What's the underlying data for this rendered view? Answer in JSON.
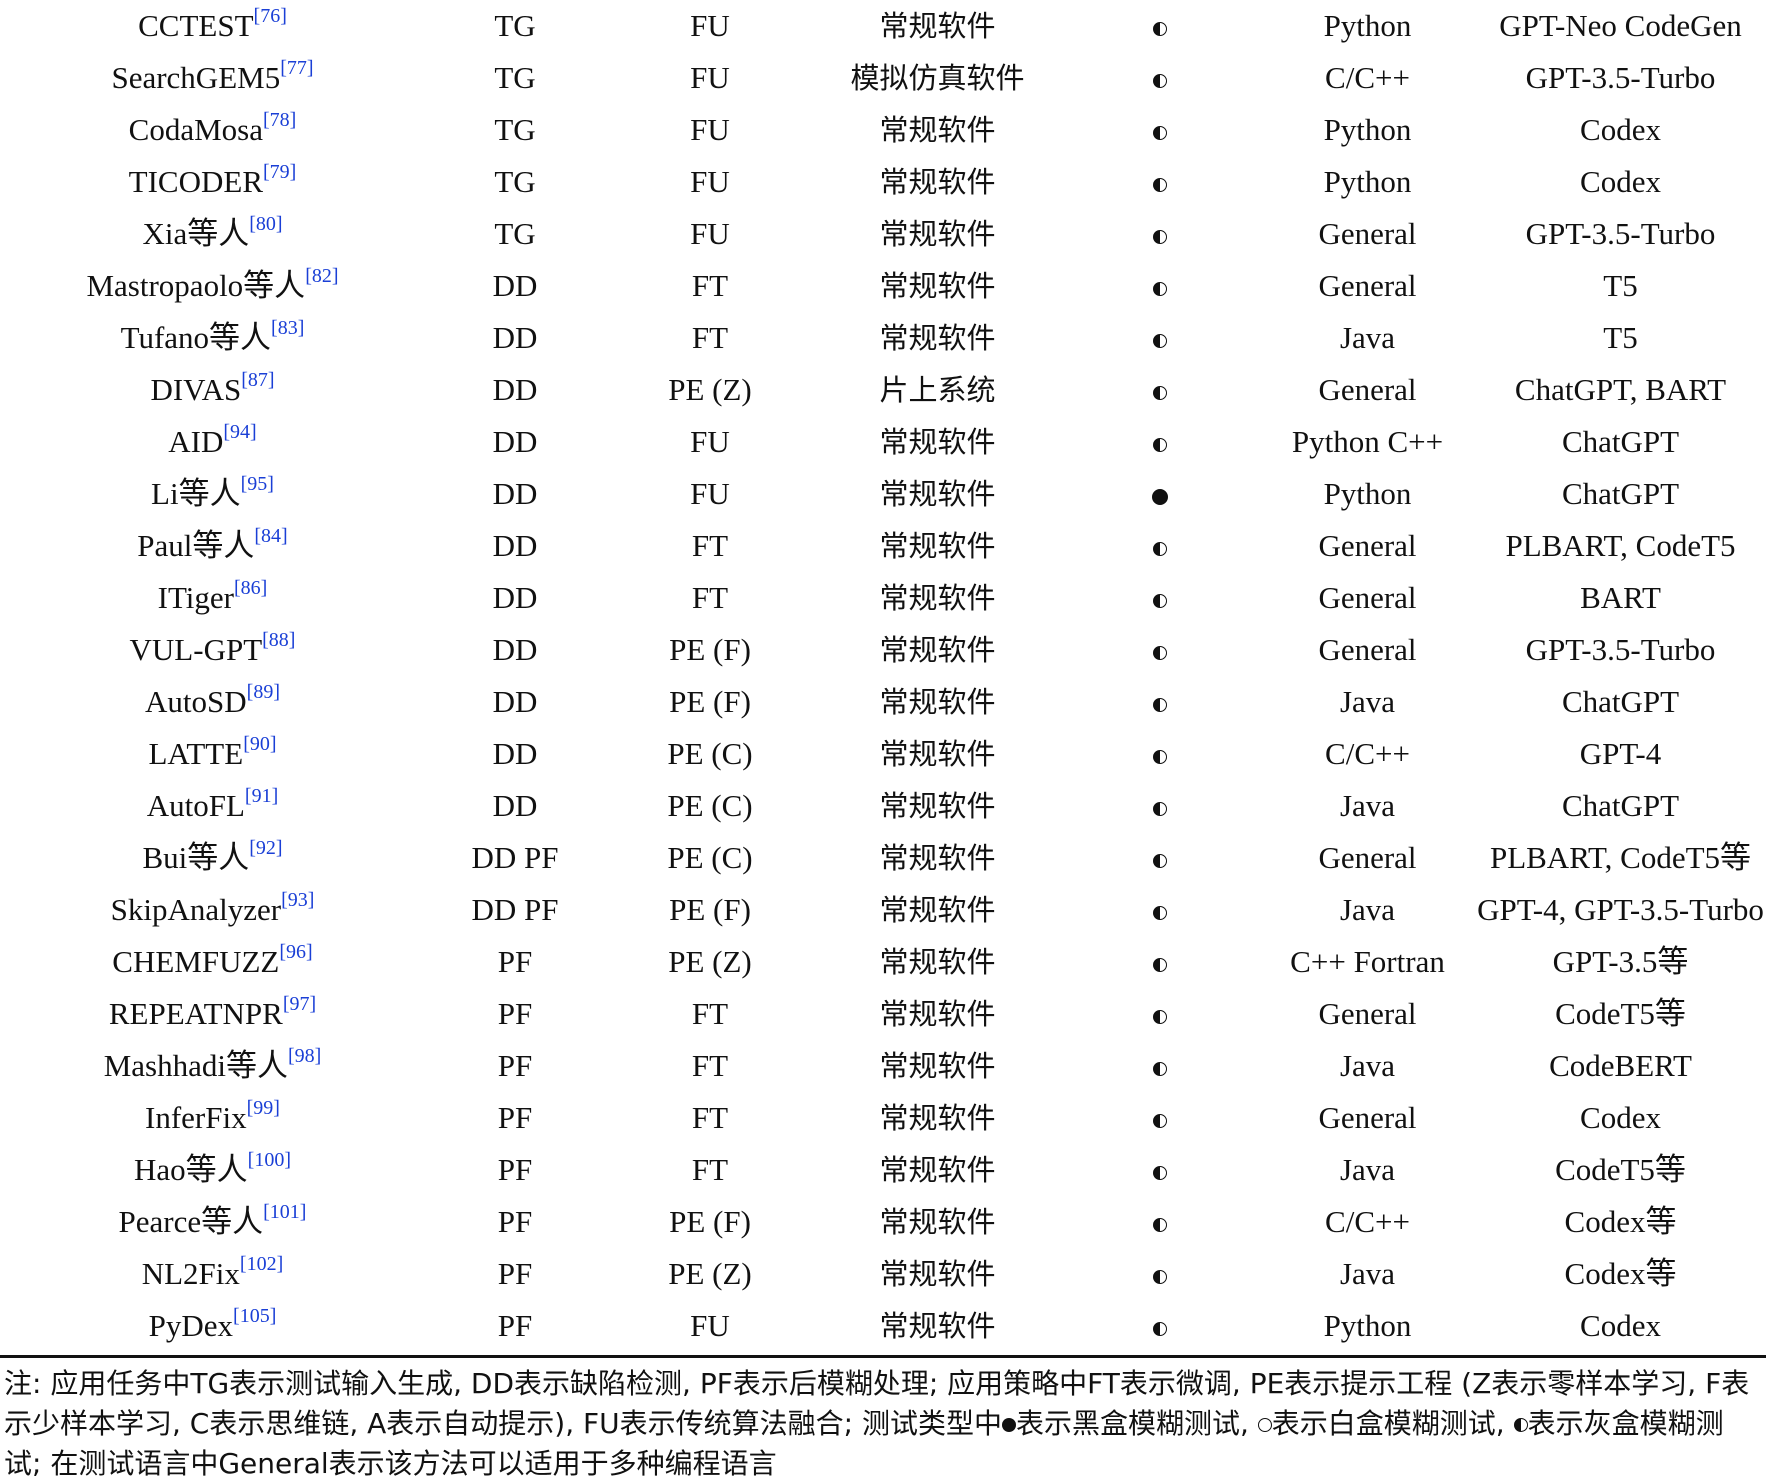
{
  "rows": [
    {
      "method": "CCTEST",
      "ref": "[76]",
      "task": "TG",
      "strategy": "FU",
      "target": "常规软件",
      "fuzz_type": "gray",
      "language": "Python",
      "model": "GPT-Neo CodeGen"
    },
    {
      "method": "SearchGEM5",
      "ref": "[77]",
      "task": "TG",
      "strategy": "FU",
      "target": "模拟仿真软件",
      "fuzz_type": "gray",
      "language": "C/C++",
      "model": "GPT-3.5-Turbo"
    },
    {
      "method": "CodaMosa",
      "ref": "[78]",
      "task": "TG",
      "strategy": "FU",
      "target": "常规软件",
      "fuzz_type": "gray",
      "language": "Python",
      "model": "Codex"
    },
    {
      "method": "TICODER",
      "ref": "[79]",
      "task": "TG",
      "strategy": "FU",
      "target": "常规软件",
      "fuzz_type": "gray",
      "language": "Python",
      "model": "Codex"
    },
    {
      "method": "Xia等人",
      "ref": "[80]",
      "task": "TG",
      "strategy": "FU",
      "target": "常规软件",
      "fuzz_type": "gray",
      "language": "General",
      "model": "GPT-3.5-Turbo"
    },
    {
      "method": "Mastropaolo等人",
      "ref": "[82]",
      "task": "DD",
      "strategy": "FT",
      "target": "常规软件",
      "fuzz_type": "gray",
      "language": "General",
      "model": "T5"
    },
    {
      "method": "Tufano等人",
      "ref": "[83]",
      "task": "DD",
      "strategy": "FT",
      "target": "常规软件",
      "fuzz_type": "gray",
      "language": "Java",
      "model": "T5"
    },
    {
      "method": "DIVAS",
      "ref": "[87]",
      "task": "DD",
      "strategy": "PE (Z)",
      "target": "片上系统",
      "fuzz_type": "gray",
      "language": "General",
      "model": "ChatGPT, BART"
    },
    {
      "method": "AID",
      "ref": "[94]",
      "task": "DD",
      "strategy": "FU",
      "target": "常规软件",
      "fuzz_type": "gray",
      "language": "Python C++",
      "model": "ChatGPT"
    },
    {
      "method": "Li等人",
      "ref": "[95]",
      "task": "DD",
      "strategy": "FU",
      "target": "常规软件",
      "fuzz_type": "black",
      "language": "Python",
      "model": "ChatGPT"
    },
    {
      "method": "Paul等人",
      "ref": "[84]",
      "task": "DD",
      "strategy": "FT",
      "target": "常规软件",
      "fuzz_type": "gray",
      "language": "General",
      "model": "PLBART, CodeT5"
    },
    {
      "method": "ITiger",
      "ref": "[86]",
      "task": "DD",
      "strategy": "FT",
      "target": "常规软件",
      "fuzz_type": "gray",
      "language": "General",
      "model": "BART"
    },
    {
      "method": "VUL-GPT",
      "ref": "[88]",
      "task": "DD",
      "strategy": "PE (F)",
      "target": "常规软件",
      "fuzz_type": "gray",
      "language": "General",
      "model": "GPT-3.5-Turbo"
    },
    {
      "method": "AutoSD",
      "ref": "[89]",
      "task": "DD",
      "strategy": "PE (F)",
      "target": "常规软件",
      "fuzz_type": "gray",
      "language": "Java",
      "model": "ChatGPT"
    },
    {
      "method": "LATTE",
      "ref": "[90]",
      "task": "DD",
      "strategy": "PE (C)",
      "target": "常规软件",
      "fuzz_type": "gray",
      "language": "C/C++",
      "model": "GPT-4"
    },
    {
      "method": "AutoFL",
      "ref": "[91]",
      "task": "DD",
      "strategy": "PE (C)",
      "target": "常规软件",
      "fuzz_type": "gray",
      "language": "Java",
      "model": "ChatGPT"
    },
    {
      "method": "Bui等人",
      "ref": "[92]",
      "task": "DD PF",
      "strategy": "PE (C)",
      "target": "常规软件",
      "fuzz_type": "gray",
      "language": "General",
      "model": "PLBART, CodeT5等"
    },
    {
      "method": "SkipAnalyzer",
      "ref": "[93]",
      "task": "DD PF",
      "strategy": "PE (F)",
      "target": "常规软件",
      "fuzz_type": "gray",
      "language": "Java",
      "model": "GPT-4, GPT-3.5-Turbo"
    },
    {
      "method": "CHEMFUZZ",
      "ref": "[96]",
      "task": "PF",
      "strategy": "PE (Z)",
      "target": "常规软件",
      "fuzz_type": "gray",
      "language": "C++ Fortran",
      "model": "GPT-3.5等"
    },
    {
      "method": "REPEATNPR",
      "ref": "[97]",
      "task": "PF",
      "strategy": "FT",
      "target": "常规软件",
      "fuzz_type": "gray",
      "language": "General",
      "model": "CodeT5等"
    },
    {
      "method": "Mashhadi等人",
      "ref": "[98]",
      "task": "PF",
      "strategy": "FT",
      "target": "常规软件",
      "fuzz_type": "gray",
      "language": "Java",
      "model": "CodeBERT"
    },
    {
      "method": "InferFix",
      "ref": "[99]",
      "task": "PF",
      "strategy": "FT",
      "target": "常规软件",
      "fuzz_type": "gray",
      "language": "General",
      "model": "Codex"
    },
    {
      "method": "Hao等人",
      "ref": "[100]",
      "task": "PF",
      "strategy": "FT",
      "target": "常规软件",
      "fuzz_type": "gray",
      "language": "Java",
      "model": "CodeT5等"
    },
    {
      "method": "Pearce等人",
      "ref": "[101]",
      "task": "PF",
      "strategy": "PE (F)",
      "target": "常规软件",
      "fuzz_type": "gray",
      "language": "C/C++",
      "model": "Codex等"
    },
    {
      "method": "NL2Fix",
      "ref": "[102]",
      "task": "PF",
      "strategy": "PE (Z)",
      "target": "常规软件",
      "fuzz_type": "gray",
      "language": "Java",
      "model": "Codex等"
    },
    {
      "method": "PyDex",
      "ref": "[105]",
      "task": "PF",
      "strategy": "FU",
      "target": "常规软件",
      "fuzz_type": "gray",
      "language": "Python",
      "model": "Codex"
    }
  ],
  "note": {
    "p1": "注: 应用任务中TG表示测试输入生成, DD表示缺陷检测, PF表示后模糊处理; 应用策略中FT表示微调, PE表示提示工程 (Z表示零样本学习, F表示少样本学习, C表示思维链, A表示自动提示), FU表示传统算法融合; 测试类型中",
    "p2": "表示黑盒模糊测试, ",
    "p3": "表示白盒模糊测试, ",
    "p4": "表示灰盒模糊测试; 在测试语言中General表示该方法可以适用于多种编程语言"
  }
}
